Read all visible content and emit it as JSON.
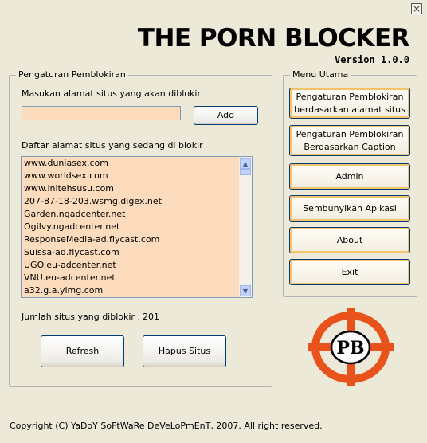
{
  "window": {
    "close_glyph": "×"
  },
  "header": {
    "title": "THE PORN BLOCKER",
    "version": "Version 1.0.0"
  },
  "blocking_settings": {
    "legend": "Pengaturan Pemblokiran",
    "input_label": "Masukan alamat situs yang akan diblokir",
    "input_value": "",
    "add_label": "Add",
    "list_label": "Daftar alamat situs yang sedang di blokir",
    "sites": [
      "www.duniasex.com",
      "www.worldsex.com",
      "www.initehsusu.com",
      "207-87-18-203.wsmg.digex.net",
      "Garden.ngadcenter.net",
      "Ogilvy.ngadcenter.net",
      "ResponseMedia-ad.flycast.com",
      "Suissa-ad.flycast.com",
      "UGO.eu-adcenter.net",
      "VNU.eu-adcenter.net",
      "a32.g.a.yimg.com"
    ],
    "count_label": "Jumlah situs yang diblokir :",
    "count_value": "201",
    "refresh_label": "Refresh",
    "delete_label": "Hapus Situs"
  },
  "main_menu": {
    "legend": "Menu Utama",
    "items": [
      {
        "line1": "Pengaturan Pemblokiran",
        "line2": "berdasarkan alamat situs"
      },
      {
        "line1": "Pengaturan Pemblokiran",
        "line2": "Berdasarkan Caption"
      },
      {
        "line1": "Admin",
        "line2": ""
      },
      {
        "line1": "Sembunyikan Apikasi",
        "line2": ""
      },
      {
        "line1": "About",
        "line2": ""
      },
      {
        "line1": "Exit",
        "line2": ""
      }
    ]
  },
  "logo": {
    "text": "PB",
    "color": "#e8531c"
  },
  "footer": {
    "copyright": "Copyright (C) YaDoY SoFtWaRe DeVeLoPmEnT, 2007. All right reserved."
  }
}
